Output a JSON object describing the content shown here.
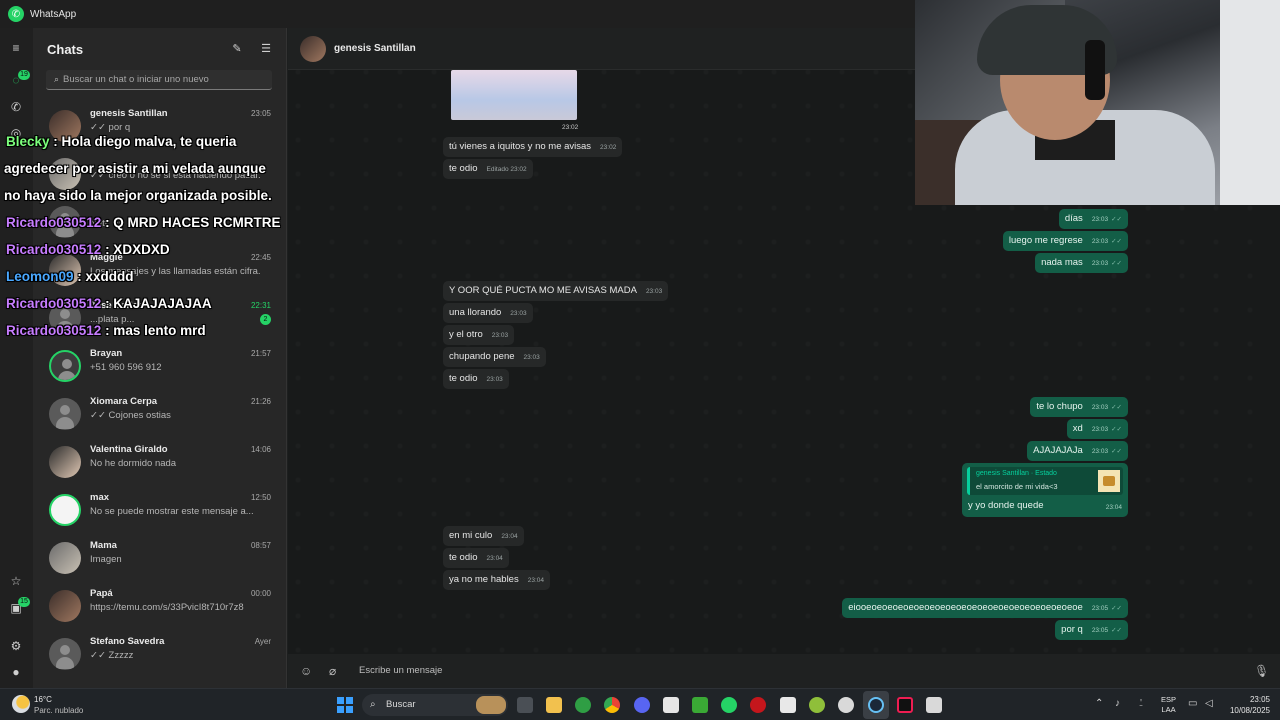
{
  "window": {
    "title": "WhatsApp"
  },
  "rail": {
    "chats_badge": "19",
    "status_badge": "15"
  },
  "chatlist": {
    "header": "Chats",
    "search_placeholder": "Buscar un chat o iniciar uno nuevo",
    "items": [
      {
        "name": "genesis Santillan",
        "time": "23:05",
        "preview": "✓✓ por q"
      },
      {
        "name": "",
        "time": "",
        "preview": "✓✓ creo o no se si esta haciendo pasar..."
      },
      {
        "name": "",
        "time": "",
        "preview": "Natt: En enero..."
      },
      {
        "name": "Maggie",
        "time": "22:45",
        "preview": "Los mensajes y las llamadas están cifra..."
      },
      {
        "name": "Jose Carlos",
        "time": "22:31",
        "preview": "...plata p...",
        "unread": "2"
      },
      {
        "name": "Brayan",
        "time": "21:57",
        "preview": "+51 960 596 912"
      },
      {
        "name": "Xiomara Cerpa",
        "time": "21:26",
        "preview": "✓✓ Cojones ostias"
      },
      {
        "name": "Valentina Giraldo",
        "time": "14:06",
        "preview": "No he dormido nada"
      },
      {
        "name": "max",
        "time": "12:50",
        "preview": "No se puede mostrar este mensaje a..."
      },
      {
        "name": "Mama",
        "time": "08:57",
        "preview": "Imagen"
      },
      {
        "name": "Papá",
        "time": "00:00",
        "preview": "https://temu.com/s/33PvicI8t710r7z8"
      },
      {
        "name": "Stefano Savedra",
        "time": "Ayer",
        "preview": "✓✓ Zzzzz"
      }
    ]
  },
  "conversation": {
    "contact_name": "genesis Santillan",
    "image_time": "23:02",
    "messages": [
      {
        "dir": "in",
        "text": "tú vienes a iquitos y no me avisas",
        "time": "23:02"
      },
      {
        "dir": "in",
        "text": "te odio",
        "time": "Editado 23:02"
      },
      {
        "dir": "out",
        "text": "días",
        "time": "23:03"
      },
      {
        "dir": "out",
        "text": "luego me regrese",
        "time": "23:03"
      },
      {
        "dir": "out",
        "text": "nada mas",
        "time": "23:03"
      },
      {
        "dir": "in",
        "text": "Y OOR QUÉ PUCTA MO ME AVISAS MADA",
        "time": "23:03"
      },
      {
        "dir": "in",
        "text": "una llorando",
        "time": "23:03"
      },
      {
        "dir": "in",
        "text": "y el otro",
        "time": "23:03"
      },
      {
        "dir": "in",
        "text": "chupando pene",
        "time": "23:03"
      },
      {
        "dir": "in",
        "text": "te odio",
        "time": "23:03"
      },
      {
        "dir": "out",
        "text": "te lo chupo",
        "time": "23:03"
      },
      {
        "dir": "out",
        "text": "xd",
        "time": "23:03"
      },
      {
        "dir": "out",
        "text": "AJAJAJAJa",
        "time": "23:03"
      },
      {
        "dir": "in",
        "text": "en mi culo",
        "time": "23:04"
      },
      {
        "dir": "in",
        "text": "te odio",
        "time": "23:04"
      },
      {
        "dir": "in",
        "text": "ya no me hables",
        "time": "23:04"
      },
      {
        "dir": "out",
        "text": "eiooeoeoeoeoeoeoeoeoeoeoeoeoeoeoeoeoeoeoeoeoe",
        "time": "23:05"
      },
      {
        "dir": "out",
        "text": "por q",
        "time": "23:05"
      }
    ],
    "reply": {
      "quote_title": "genesis Santillan · Estado",
      "quote_text": "el amorcito de mi vida<3",
      "text": "y yo donde quede",
      "time": "23:04"
    },
    "composer_placeholder": "Escribe un mensaje"
  },
  "overlay": {
    "lines": [
      {
        "user": "Blecky",
        "color": "#7cff7c",
        "text": " : Hola diego malva, te queria"
      },
      {
        "user": "",
        "color": "#ffffff",
        "text": "agredecer por asistir a mi velada aunque"
      },
      {
        "user": "",
        "color": "#ffffff",
        "text": "no haya sido la mejor organizada posible."
      },
      {
        "user": "Ricardo030512",
        "color": "#c77dff",
        "text": " : Q MRD HACES RCMRTRE"
      },
      {
        "user": "Ricardo030512",
        "color": "#c77dff",
        "text": " : XDXDXD"
      },
      {
        "user": "Leomon09",
        "color": "#4aa8ff",
        "text": " : xxdddd"
      },
      {
        "user": "Ricardo030512",
        "color": "#c77dff",
        "text": " : KAJAJAJAJAA"
      },
      {
        "user": "Ricardo030512",
        "color": "#c77dff",
        "text": " : mas lento mrd"
      }
    ]
  },
  "taskbar": {
    "weather_temp": "16°C",
    "weather_desc": "Parc. nublado",
    "search_label": "Buscar",
    "lang_line1": "ESP",
    "lang_line2": "LAA",
    "time": "23:05",
    "date": "10/08/2025",
    "badges": {
      "xbox": "1",
      "discord": "9+",
      "whatsapp": "19"
    }
  },
  "colors": {
    "accent": "#25d366",
    "outgoing": "#135e47",
    "incoming": "#262828"
  }
}
